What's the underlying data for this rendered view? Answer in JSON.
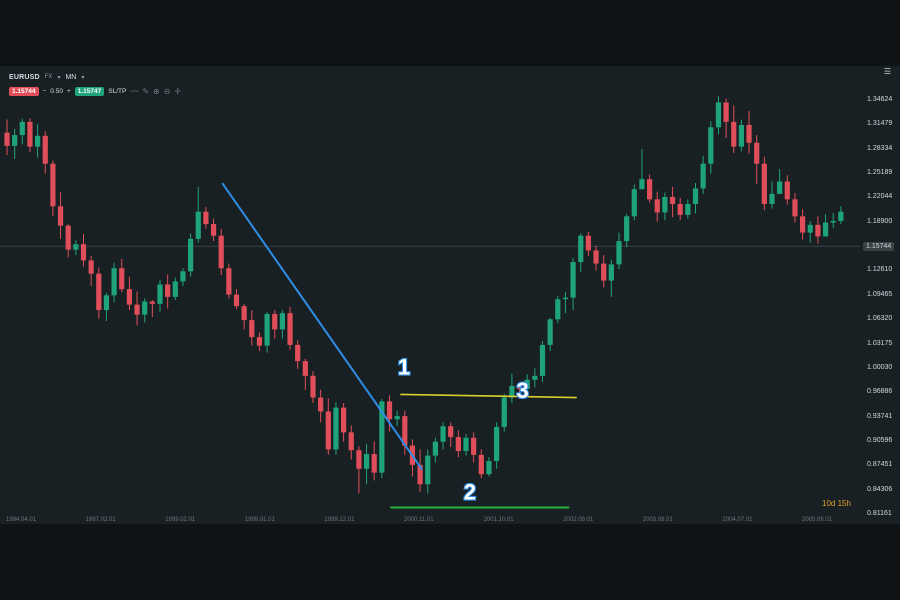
{
  "toolbar": {
    "symbol": "EURUSD",
    "market": "FX",
    "timeframe": "MN",
    "bid": "1.15744",
    "spread": "0.50",
    "ask": "1.15747",
    "sltp": "SL/TP",
    "minus": "−",
    "plus": "+",
    "caret": "▾"
  },
  "timer": "10d 15h",
  "colors": {
    "background": "#192024",
    "up": "#1fa37a",
    "down": "#e04f59",
    "trendline": "#2f8de4",
    "neckline": "#d8cf2e",
    "support": "#23b33a",
    "current_price_line": "#3a4347"
  },
  "annotations": [
    {
      "label": "1"
    },
    {
      "label": "2"
    },
    {
      "label": "3"
    }
  ],
  "chart_data": {
    "type": "candlestick",
    "y_ticks": [
      "1.34624",
      "1.31479",
      "1.28334",
      "1.25189",
      "1.22044",
      "1.18900",
      "1.15744",
      "1.12610",
      "1.09465",
      "1.06320",
      "1.03175",
      "1.00030",
      "0.96886",
      "0.93741",
      "0.90596",
      "0.87451",
      "0.84306",
      "0.81161"
    ],
    "x_ticks": [
      "1994.04.01",
      "1997.02.01",
      "1999.02.01",
      "1999.01.01",
      "1999.12.01",
      "2000.11.01",
      "2001.10.01",
      "2002.09.01",
      "2003.08.01",
      "2004.07.01",
      "2005.06.01"
    ],
    "ylim": [
      0.81161,
      1.34624
    ],
    "current_price": 1.15744,
    "candles": [
      [
        1.304,
        1.287,
        1.321,
        1.275
      ],
      [
        1.287,
        1.301,
        1.309,
        1.27
      ],
      [
        1.301,
        1.318,
        1.322,
        1.289
      ],
      [
        1.318,
        1.286,
        1.323,
        1.279
      ],
      [
        1.286,
        1.3,
        1.315,
        1.272
      ],
      [
        1.3,
        1.264,
        1.306,
        1.251
      ],
      [
        1.264,
        1.209,
        1.268,
        1.196
      ],
      [
        1.209,
        1.184,
        1.227,
        1.167
      ],
      [
        1.184,
        1.153,
        1.186,
        1.143
      ],
      [
        1.153,
        1.16,
        1.165,
        1.146
      ],
      [
        1.16,
        1.139,
        1.173,
        1.131
      ],
      [
        1.139,
        1.122,
        1.145,
        1.106
      ],
      [
        1.122,
        1.075,
        1.13,
        1.064
      ],
      [
        1.075,
        1.094,
        1.097,
        1.061
      ],
      [
        1.094,
        1.129,
        1.136,
        1.085
      ],
      [
        1.129,
        1.102,
        1.141,
        1.098
      ],
      [
        1.102,
        1.082,
        1.118,
        1.075
      ],
      [
        1.082,
        1.069,
        1.099,
        1.055
      ],
      [
        1.069,
        1.086,
        1.09,
        1.059
      ],
      [
        1.086,
        1.083,
        1.088,
        1.066
      ],
      [
        1.083,
        1.108,
        1.114,
        1.073
      ],
      [
        1.108,
        1.092,
        1.121,
        1.077
      ],
      [
        1.092,
        1.112,
        1.117,
        1.088
      ],
      [
        1.112,
        1.125,
        1.129,
        1.106
      ],
      [
        1.125,
        1.167,
        1.174,
        1.118
      ],
      [
        1.167,
        1.202,
        1.234,
        1.162
      ],
      [
        1.202,
        1.186,
        1.208,
        1.18
      ],
      [
        1.186,
        1.171,
        1.193,
        1.164
      ],
      [
        1.171,
        1.129,
        1.18,
        1.12
      ],
      [
        1.129,
        1.095,
        1.135,
        1.09
      ],
      [
        1.095,
        1.08,
        1.102,
        1.076
      ],
      [
        1.08,
        1.062,
        1.083,
        1.05
      ],
      [
        1.062,
        1.04,
        1.075,
        1.029
      ],
      [
        1.04,
        1.029,
        1.046,
        1.022
      ],
      [
        1.029,
        1.07,
        1.072,
        1.02
      ],
      [
        1.07,
        1.05,
        1.075,
        1.038
      ],
      [
        1.05,
        1.071,
        1.075,
        1.038
      ],
      [
        1.071,
        1.03,
        1.079,
        1.024
      ],
      [
        1.03,
        1.009,
        1.036,
        0.999
      ],
      [
        1.009,
        0.99,
        1.012,
        0.972
      ],
      [
        0.99,
        0.962,
        0.996,
        0.955
      ],
      [
        0.962,
        0.944,
        0.972,
        0.93
      ],
      [
        0.944,
        0.895,
        0.961,
        0.888
      ],
      [
        0.895,
        0.949,
        0.956,
        0.888
      ],
      [
        0.949,
        0.917,
        0.955,
        0.905
      ],
      [
        0.917,
        0.894,
        0.926,
        0.882
      ],
      [
        0.894,
        0.87,
        0.899,
        0.838
      ],
      [
        0.87,
        0.889,
        0.902,
        0.85
      ],
      [
        0.889,
        0.865,
        0.905,
        0.855
      ],
      [
        0.865,
        0.957,
        0.96,
        0.858
      ],
      [
        0.957,
        0.934,
        0.965,
        0.918
      ],
      [
        0.934,
        0.938,
        0.945,
        0.925
      ],
      [
        0.938,
        0.9,
        0.945,
        0.888
      ],
      [
        0.9,
        0.875,
        0.908,
        0.86
      ],
      [
        0.875,
        0.85,
        0.895,
        0.84
      ],
      [
        0.85,
        0.887,
        0.895,
        0.838
      ],
      [
        0.887,
        0.905,
        0.91,
        0.878
      ],
      [
        0.905,
        0.925,
        0.93,
        0.895
      ],
      [
        0.925,
        0.911,
        0.93,
        0.898
      ],
      [
        0.911,
        0.893,
        0.92,
        0.885
      ],
      [
        0.893,
        0.91,
        0.915,
        0.887
      ],
      [
        0.91,
        0.888,
        0.917,
        0.878
      ],
      [
        0.888,
        0.863,
        0.895,
        0.858
      ],
      [
        0.863,
        0.88,
        0.885,
        0.86
      ],
      [
        0.88,
        0.924,
        0.93,
        0.87
      ],
      [
        0.924,
        0.962,
        0.967,
        0.918
      ],
      [
        0.962,
        0.977,
        0.993,
        0.955
      ],
      [
        0.977,
        0.973,
        0.98,
        0.96
      ],
      [
        0.973,
        0.985,
        0.992,
        0.965
      ],
      [
        0.985,
        0.99,
        1.0,
        0.975
      ],
      [
        0.99,
        1.03,
        1.035,
        0.982
      ],
      [
        1.03,
        1.063,
        1.065,
        1.022
      ],
      [
        1.063,
        1.089,
        1.093,
        1.058
      ],
      [
        1.089,
        1.091,
        1.098,
        1.071
      ],
      [
        1.091,
        1.137,
        1.142,
        1.075
      ],
      [
        1.137,
        1.171,
        1.174,
        1.124
      ],
      [
        1.171,
        1.152,
        1.176,
        1.145
      ],
      [
        1.152,
        1.135,
        1.158,
        1.126
      ],
      [
        1.135,
        1.113,
        1.146,
        1.104
      ],
      [
        1.113,
        1.134,
        1.14,
        1.092
      ],
      [
        1.134,
        1.164,
        1.175,
        1.128
      ],
      [
        1.164,
        1.196,
        1.199,
        1.156
      ],
      [
        1.196,
        1.231,
        1.237,
        1.191
      ],
      [
        1.231,
        1.244,
        1.283,
        1.236
      ],
      [
        1.244,
        1.218,
        1.25,
        1.214
      ],
      [
        1.218,
        1.201,
        1.228,
        1.189
      ],
      [
        1.201,
        1.221,
        1.227,
        1.191
      ],
      [
        1.221,
        1.212,
        1.234,
        1.195
      ],
      [
        1.212,
        1.198,
        1.22,
        1.191
      ],
      [
        1.198,
        1.212,
        1.218,
        1.193
      ],
      [
        1.212,
        1.232,
        1.239,
        1.2
      ],
      [
        1.232,
        1.264,
        1.274,
        1.225
      ],
      [
        1.264,
        1.311,
        1.319,
        1.251
      ],
      [
        1.311,
        1.343,
        1.351,
        1.302
      ],
      [
        1.343,
        1.318,
        1.348,
        1.297
      ],
      [
        1.318,
        1.286,
        1.339,
        1.278
      ],
      [
        1.286,
        1.314,
        1.321,
        1.28
      ],
      [
        1.314,
        1.291,
        1.332,
        1.277
      ],
      [
        1.291,
        1.264,
        1.301,
        1.238
      ],
      [
        1.264,
        1.212,
        1.273,
        1.204
      ],
      [
        1.212,
        1.225,
        1.241,
        1.206
      ],
      [
        1.225,
        1.241,
        1.257,
        1.228
      ],
      [
        1.241,
        1.218,
        1.249,
        1.211
      ],
      [
        1.218,
        1.196,
        1.226,
        1.188
      ],
      [
        1.196,
        1.175,
        1.205,
        1.166
      ],
      [
        1.175,
        1.185,
        1.19,
        1.162
      ],
      [
        1.185,
        1.17,
        1.196,
        1.161
      ],
      [
        1.17,
        1.188,
        1.199,
        1.174
      ],
      [
        1.188,
        1.19,
        1.2,
        1.181
      ],
      [
        1.19,
        1.202,
        1.209,
        1.186
      ]
    ]
  }
}
